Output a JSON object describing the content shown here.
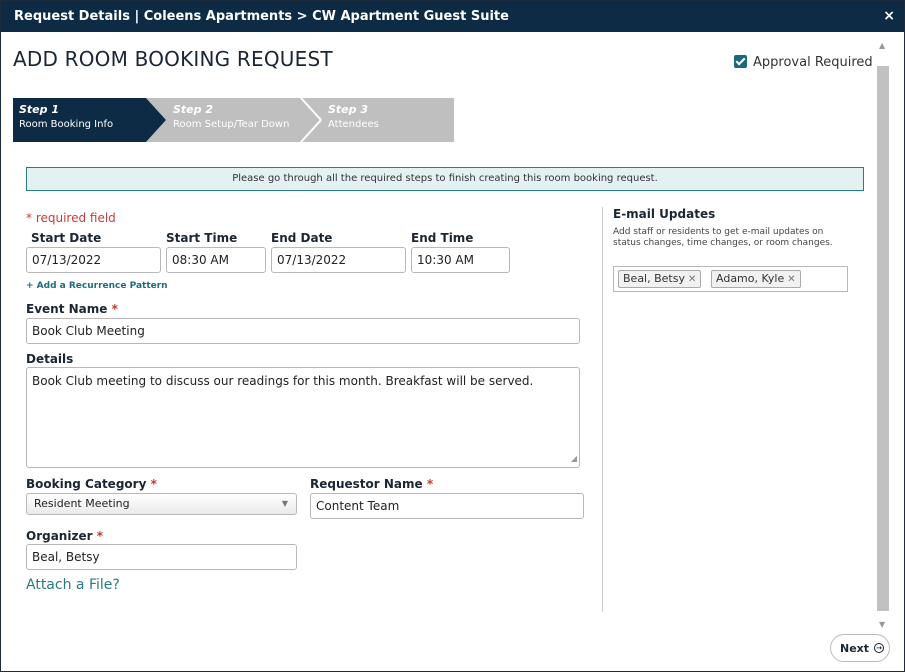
{
  "window": {
    "title": "Request Details | Coleens Apartments > CW Apartment Guest Suite",
    "close": "×"
  },
  "page": {
    "heading": "ADD ROOM BOOKING REQUEST",
    "approval_label": "Approval Required",
    "approval_checked": true
  },
  "steps": [
    {
      "num": "Step 1",
      "label": "Room Booking Info",
      "active": true
    },
    {
      "num": "Step 2",
      "label": "Room Setup/Tear Down",
      "active": false
    },
    {
      "num": "Step 3",
      "label": "Attendees",
      "active": false
    }
  ],
  "notice": "Please go through all the required steps to finish creating this room booking request.",
  "required_note": "* required field",
  "form": {
    "start_date_label": "Start Date",
    "start_date": "07/13/2022",
    "start_time_label": "Start Time",
    "start_time": "08:30 AM",
    "end_date_label": "End Date",
    "end_date": "07/13/2022",
    "end_time_label": "End Time",
    "end_time": "10:30 AM",
    "recurrence_link": "+ Add a Recurrence Pattern",
    "event_name_label": "Event Name",
    "event_name": "Book Club Meeting",
    "details_label": "Details",
    "details": "Book Club meeting to discuss our readings for this month. Breakfast will be served.",
    "booking_category_label": "Booking Category",
    "booking_category": "Resident Meeting",
    "requestor_label": "Requestor Name",
    "requestor": "Content Team",
    "organizer_label": "Organizer",
    "organizer": "Beal, Betsy",
    "required_mark": "*",
    "attach_link": "Attach a File?"
  },
  "email": {
    "title": "E-mail Updates",
    "hint": "Add staff or residents to get e-mail updates on status changes, time changes, or room changes.",
    "tags": [
      "Beal, Betsy",
      "Adamo, Kyle"
    ],
    "tag_remove": "✕"
  },
  "footer": {
    "next_label": "Next",
    "next_icon": "→"
  },
  "colors": {
    "header": "#0d2b45",
    "step_active": "#0d2b45",
    "step_inactive": "#bfbfbf",
    "accent": "#2a7a82",
    "required": "#c53c3c"
  }
}
